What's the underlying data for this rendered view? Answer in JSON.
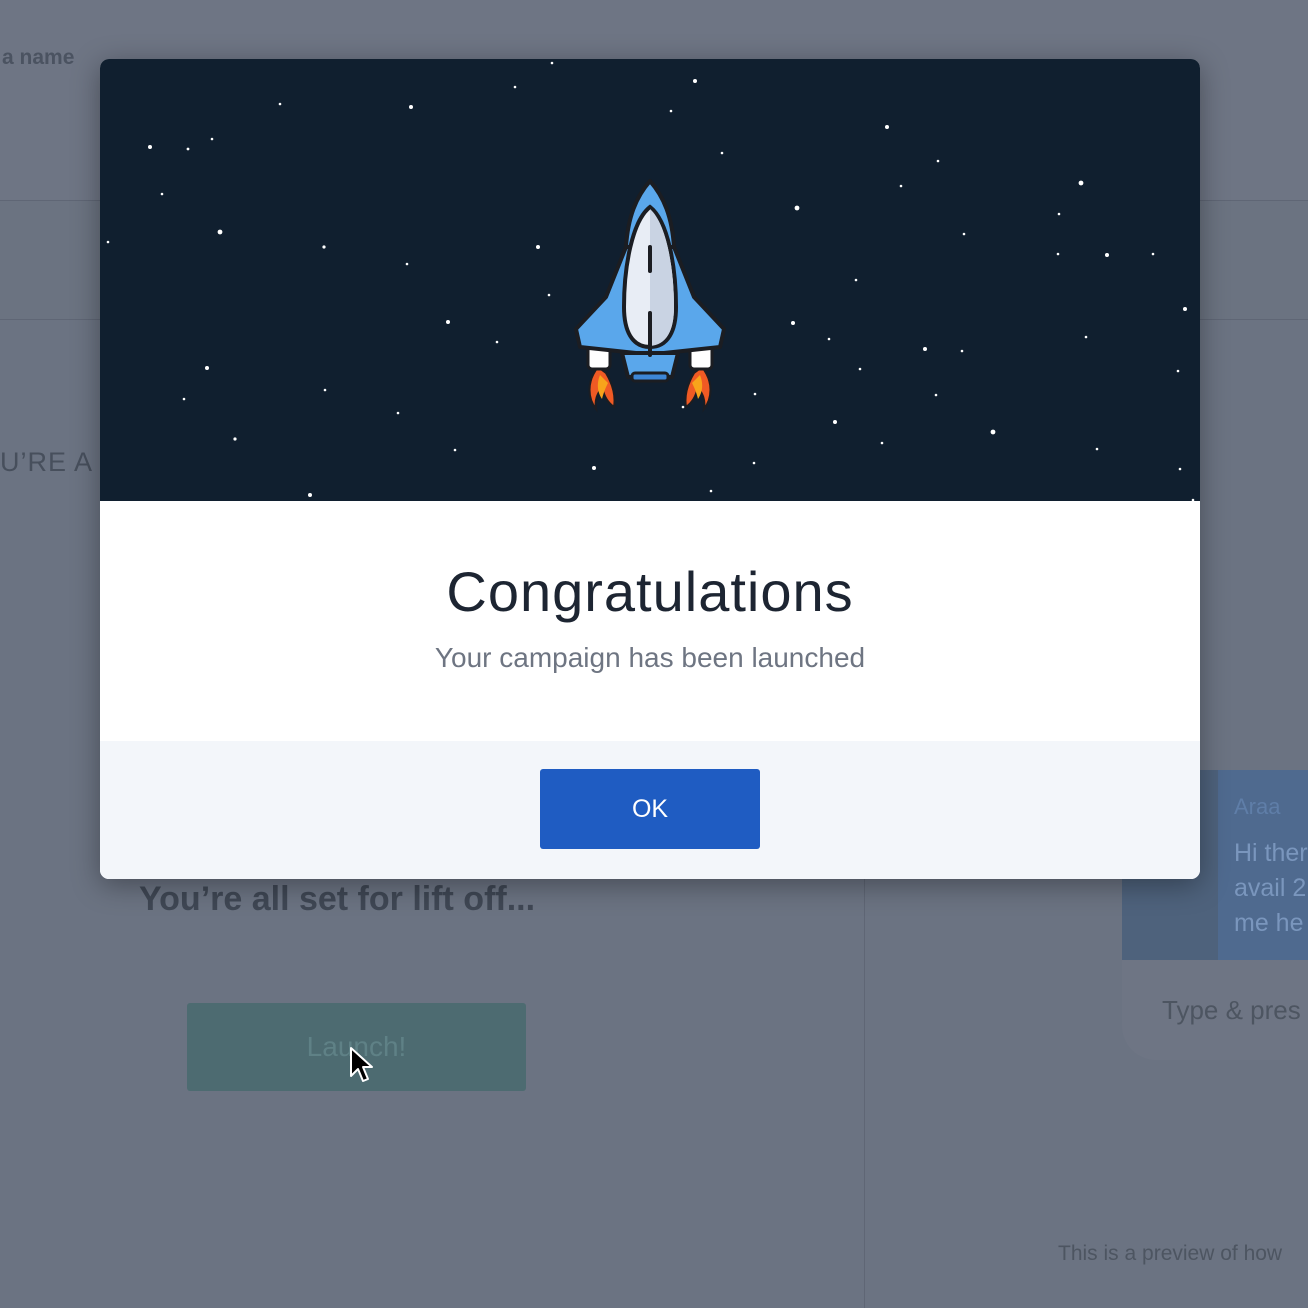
{
  "background": {
    "name_label": "a name",
    "section_heading": "U’RE A",
    "liftoff_heading": "You’re all set for lift off...",
    "launch_button": "Launch!",
    "chat": {
      "sender": "Araa",
      "message": "Hi ther\navail 2\nme he",
      "input_placeholder": "Type & pres"
    },
    "preview_note": "This is a preview of how"
  },
  "modal": {
    "title": "Congratulations",
    "subtitle": "Your campaign has been launched",
    "ok_label": "OK",
    "hero_image": "rocket-launch-illustration"
  },
  "colors": {
    "hero_background": "#101f2f",
    "ok_button": "#1f5cc2",
    "launch_button": "#4d6b71"
  }
}
